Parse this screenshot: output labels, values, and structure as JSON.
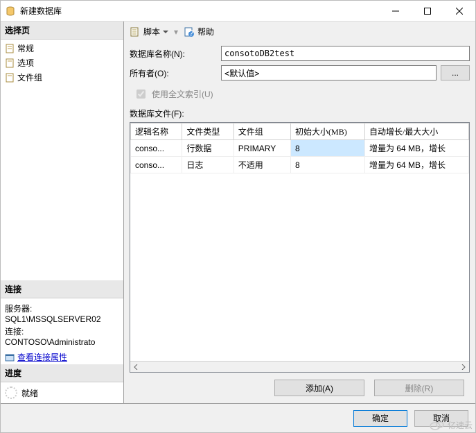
{
  "window": {
    "title": "新建数据库"
  },
  "sidebar": {
    "select_page_header": "选择页",
    "pages": [
      {
        "label": "常规"
      },
      {
        "label": "选项"
      },
      {
        "label": "文件组"
      }
    ],
    "connection_header": "连接",
    "server_label": "服务器:",
    "server_value": "SQL1\\MSSQLSERVER02",
    "conn_label": "连接:",
    "conn_value": "CONTOSO\\Administrato",
    "view_props": "查看连接属性",
    "progress_header": "进度",
    "progress_status": "就绪"
  },
  "toolbar": {
    "script_label": "脚本",
    "help_label": "帮助"
  },
  "form": {
    "db_name_label": "数据库名称(N):",
    "db_name_value": "consotoDB2test",
    "owner_label": "所有者(O):",
    "owner_value": "<默认值>",
    "owner_browse": "...",
    "fulltext_label": "使用全文索引(U)",
    "files_label": "数据库文件(F):"
  },
  "grid": {
    "headers": {
      "logical_name": "逻辑名称",
      "file_type": "文件类型",
      "filegroup": "文件组",
      "init_size": "初始大小(MB)",
      "autogrowth": "自动增长/最大大小"
    },
    "rows": [
      {
        "logical_name": "conso...",
        "file_type": "行数据",
        "filegroup": "PRIMARY",
        "init_size": "8",
        "autogrowth": "增量为 64 MB，增长"
      },
      {
        "logical_name": "conso...",
        "file_type": "日志",
        "filegroup": "不适用",
        "init_size": "8",
        "autogrowth": "增量为 64 MB，增长"
      }
    ]
  },
  "buttons": {
    "add": "添加(A)",
    "delete": "删除(R)",
    "ok": "确定",
    "cancel": "取消"
  },
  "watermark": "亿速云"
}
